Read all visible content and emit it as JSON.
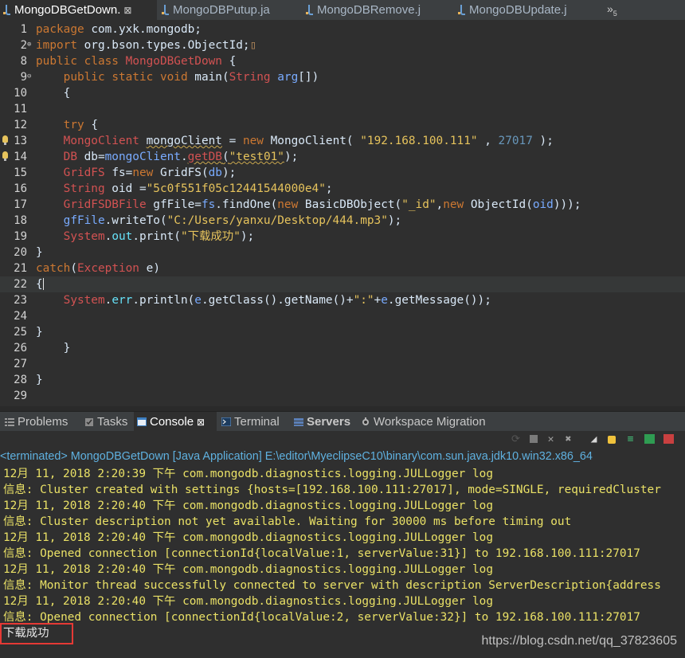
{
  "editor_tabs": [
    {
      "label": "MongoDBGetDown.",
      "close": "⊠",
      "active": true
    },
    {
      "label": "MongoDBPutup.ja",
      "active": false
    },
    {
      "label": "MongoDBRemove.j",
      "active": false
    },
    {
      "label": "MongoDBUpdate.j",
      "active": false
    }
  ],
  "tab_overflow": {
    "symbol": "»",
    "count": "5"
  },
  "code_lines": [
    {
      "n": "1",
      "fold": "",
      "bulb": false,
      "cur": false
    },
    {
      "n": "2",
      "fold": "⊕",
      "bulb": false,
      "cur": false
    },
    {
      "n": "8",
      "fold": "",
      "bulb": false,
      "cur": false
    },
    {
      "n": "9",
      "fold": "⊖",
      "bulb": false,
      "cur": false
    },
    {
      "n": "10",
      "fold": "",
      "bulb": false,
      "cur": false
    },
    {
      "n": "11",
      "fold": "",
      "bulb": false,
      "cur": false
    },
    {
      "n": "12",
      "fold": "",
      "bulb": false,
      "cur": false
    },
    {
      "n": "13",
      "fold": "",
      "bulb": true,
      "cur": false
    },
    {
      "n": "14",
      "fold": "",
      "bulb": true,
      "cur": false
    },
    {
      "n": "15",
      "fold": "",
      "bulb": false,
      "cur": false
    },
    {
      "n": "16",
      "fold": "",
      "bulb": false,
      "cur": false
    },
    {
      "n": "17",
      "fold": "",
      "bulb": false,
      "cur": false
    },
    {
      "n": "18",
      "fold": "",
      "bulb": false,
      "cur": false
    },
    {
      "n": "19",
      "fold": "",
      "bulb": false,
      "cur": false
    },
    {
      "n": "20",
      "fold": "",
      "bulb": false,
      "cur": false
    },
    {
      "n": "21",
      "fold": "",
      "bulb": false,
      "cur": false
    },
    {
      "n": "22",
      "fold": "",
      "bulb": false,
      "cur": true
    },
    {
      "n": "23",
      "fold": "",
      "bulb": false,
      "cur": false
    },
    {
      "n": "24",
      "fold": "",
      "bulb": false,
      "cur": false
    },
    {
      "n": "25",
      "fold": "",
      "bulb": false,
      "cur": false
    },
    {
      "n": "26",
      "fold": "",
      "bulb": false,
      "cur": false
    },
    {
      "n": "27",
      "fold": "",
      "bulb": false,
      "cur": false
    },
    {
      "n": "28",
      "fold": "",
      "bulb": false,
      "cur": false
    },
    {
      "n": "29",
      "fold": "",
      "bulb": false,
      "cur": false
    }
  ],
  "code": {
    "l1": [
      "package",
      " com.yxk.mongodb;"
    ],
    "l2": [
      "import",
      " org.bson.types.ObjectId;"
    ],
    "l8": [
      "public",
      " ",
      "class",
      " ",
      "MongoDBGetDown",
      " {"
    ],
    "l9": [
      "    ",
      "public",
      " ",
      "static",
      " ",
      "void",
      " main(",
      "String",
      " ",
      "arg",
      "[])"
    ],
    "l10": "    {",
    "l12": [
      "    ",
      "try",
      " {"
    ],
    "l13": [
      "    ",
      "MongoClient",
      " ",
      "mongoClient",
      " = ",
      "new",
      " MongoClient( ",
      "\"192.168.100.111\"",
      " , ",
      "27017",
      " );"
    ],
    "l14": [
      "    ",
      "DB",
      " db=",
      "mongoClient",
      ".",
      "getDB",
      "(",
      "\"test01\"",
      ");"
    ],
    "l15": [
      "    ",
      "GridFS",
      " ",
      "fs",
      "=",
      "new",
      " GridFS(",
      "db",
      ");"
    ],
    "l16": [
      "    ",
      "String",
      " oid =",
      "\"5c0f551f05c12441544000e4\"",
      ";"
    ],
    "l17": [
      "    ",
      "GridFSDBFile",
      " gfFile=",
      "fs",
      ".findOne(",
      "new",
      " BasicDBObject(",
      "\"_id\"",
      ",",
      "new",
      " ObjectId(",
      "oid",
      ")));"
    ],
    "l18": [
      "    ",
      "gfFile",
      ".writeTo(",
      "\"C:/Users/yanxu/Desktop/444.mp3\"",
      ");"
    ],
    "l19": [
      "    ",
      "System",
      ".",
      "out",
      ".print(",
      "\"下载成功\"",
      ");"
    ],
    "l20": "}",
    "l21": [
      "catch",
      "(",
      "Exception",
      " ",
      "e",
      ")"
    ],
    "l22": "{",
    "l23": [
      "    ",
      "System",
      ".",
      "err",
      ".println(",
      "e",
      ".getClass().getName()+",
      "\":\"",
      "+",
      "e",
      ".getMessage());"
    ],
    "l25": "}",
    "l26": "    }",
    "l28": "}"
  },
  "views_tabs": [
    {
      "label": "Problems",
      "icon": "problems-icon",
      "active": false
    },
    {
      "label": "Tasks",
      "icon": "tasks-icon",
      "active": false
    },
    {
      "label": "Console",
      "icon": "console-icon",
      "active": true,
      "close": "⊠"
    },
    {
      "label": "Terminal",
      "icon": "terminal-icon",
      "active": false
    },
    {
      "label": "Servers",
      "icon": "servers-icon",
      "active": false
    },
    {
      "label": "Workspace Migration",
      "icon": "workspace-migration-icon",
      "active": false
    }
  ],
  "console": {
    "header": "<terminated> MongoDBGetDown [Java Application] E:\\editor\\MyeclipseC10\\binary\\com.sun.java.jdk10.win32.x86_64",
    "lines": [
      {
        "text": "12月 11, 2018 2:20:39 下午 com.mongodb.diagnostics.logging.JULLogger log",
        "kind": "red"
      },
      {
        "text": "信息: Cluster created with settings {hosts=[192.168.100.111:27017], mode=SINGLE, requiredCluster",
        "kind": "red"
      },
      {
        "text": "12月 11, 2018 2:20:40 下午 com.mongodb.diagnostics.logging.JULLogger log",
        "kind": "red"
      },
      {
        "text": "信息: Cluster description not yet available. Waiting for 30000 ms before timing out",
        "kind": "red"
      },
      {
        "text": "12月 11, 2018 2:20:40 下午 com.mongodb.diagnostics.logging.JULLogger log",
        "kind": "red"
      },
      {
        "text": "信息: Opened connection [connectionId{localValue:1, serverValue:31}] to 192.168.100.111:27017",
        "kind": "red"
      },
      {
        "text": "12月 11, 2018 2:20:40 下午 com.mongodb.diagnostics.logging.JULLogger log",
        "kind": "red"
      },
      {
        "text": "信息: Monitor thread successfully connected to server with description ServerDescription{address",
        "kind": "red"
      },
      {
        "text": "12月 11, 2018 2:20:40 下午 com.mongodb.diagnostics.logging.JULLogger log",
        "kind": "red"
      },
      {
        "text": "信息: Opened connection [connectionId{localValue:2, serverValue:32}] to 192.168.100.111:27017",
        "kind": "red"
      },
      {
        "text": "下载成功",
        "kind": "out"
      }
    ]
  },
  "watermark": "https://blog.csdn.net/qq_37823605",
  "colors": {
    "background": "#2f2f2f",
    "keyword": "#cc7832",
    "string": "#e6c35c",
    "number": "#6897bb",
    "console_log": "#eae166",
    "terminated_link": "#5fb1e0",
    "highlight_box": "#e53935"
  }
}
